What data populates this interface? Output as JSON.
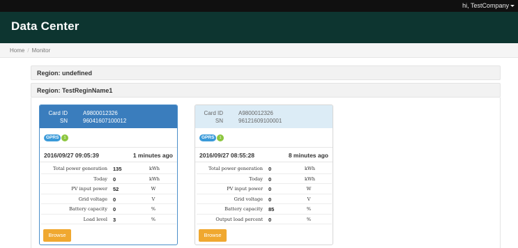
{
  "topbar": {
    "user_greeting": "hi,  TestCompany"
  },
  "header": {
    "title": "Data Center"
  },
  "breadcrumb": {
    "home": "Home",
    "separator": "/",
    "current": "Monitor"
  },
  "regions": [
    {
      "label": "Region: undefined"
    },
    {
      "label": "Region: TestReginName1"
    }
  ],
  "cards": [
    {
      "card_id_label": "Card ID",
      "card_id": "A9800012326",
      "sn_label": "SN",
      "sn": "96041607100012",
      "badge": "GPRS",
      "badge_count": "1",
      "timestamp": "2016/09/27 09:05:39",
      "ago": "1 minutes ago",
      "metrics": [
        {
          "label": "Total power generation",
          "value": "135",
          "unit": "kWh"
        },
        {
          "label": "Today",
          "value": "0",
          "unit": "kWh"
        },
        {
          "label": "PV input power",
          "value": "52",
          "unit": "W"
        },
        {
          "label": "Grid voltage",
          "value": "0",
          "unit": "V"
        },
        {
          "label": "Battery capacity",
          "value": "0",
          "unit": "%"
        },
        {
          "label": "Load level",
          "value": "3",
          "unit": "%"
        }
      ],
      "browse_label": "Browse"
    },
    {
      "card_id_label": "Card ID",
      "card_id": "A9800012326",
      "sn_label": "SN",
      "sn": "96121609100001",
      "badge": "GPRS",
      "badge_count": "1",
      "timestamp": "2016/09/27 08:55:28",
      "ago": "8 minutes ago",
      "metrics": [
        {
          "label": "Total power generation",
          "value": "0",
          "unit": "kWh"
        },
        {
          "label": "Today",
          "value": "0",
          "unit": "kWh"
        },
        {
          "label": "PV input power",
          "value": "0",
          "unit": "W"
        },
        {
          "label": "Grid voltage",
          "value": "0",
          "unit": "V"
        },
        {
          "label": "Battery capacity",
          "value": "85",
          "unit": "%"
        },
        {
          "label": "Output load percent",
          "value": "0",
          "unit": "%"
        }
      ],
      "browse_label": "Browse"
    }
  ],
  "colors": {
    "header_bg": "#0d3530",
    "topbar_bg": "#101010",
    "card_head_selected": "#3a7dbd",
    "card_head_default": "#dcecf6",
    "gprs_badge": "#3a9ad9",
    "status_dot": "#8cc63f",
    "browse_button": "#f0a830"
  }
}
